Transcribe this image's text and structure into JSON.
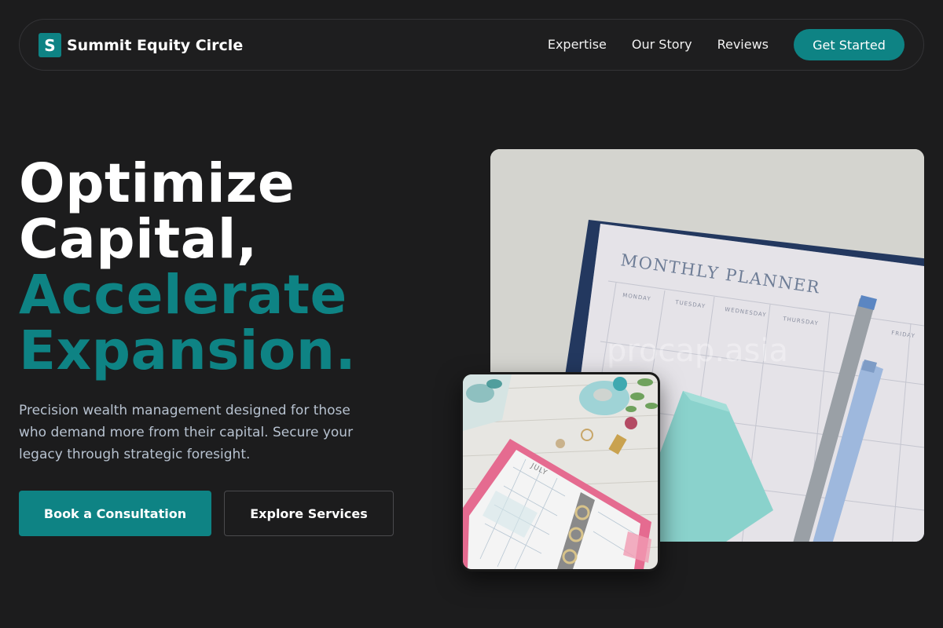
{
  "brand": {
    "logo_letter": "S",
    "name": "Summit Equity Circle",
    "accent_color": "#0e8384"
  },
  "nav": {
    "links": [
      "Expertise",
      "Our Story",
      "Reviews"
    ],
    "cta_label": "Get Started"
  },
  "hero": {
    "headline_lines": [
      "Optimize",
      "Capital,"
    ],
    "headline_accent_lines": [
      "Accelerate",
      "Expansion."
    ],
    "subtext": "Precision wealth management designed for those who demand more from their capital. Secure your legacy through strategic foresight.",
    "primary_button": "Book a Consultation",
    "secondary_button": "Explore Services"
  },
  "images": {
    "main": {
      "planner_title": "MONTHLY PLANNER",
      "day_labels": [
        "MONDAY",
        "TUESDAY",
        "WEDNESDAY",
        "THURSDAY",
        "FRIDAY"
      ],
      "watermark": "procap.asia"
    },
    "secondary": {
      "month_label": "JULY"
    }
  }
}
